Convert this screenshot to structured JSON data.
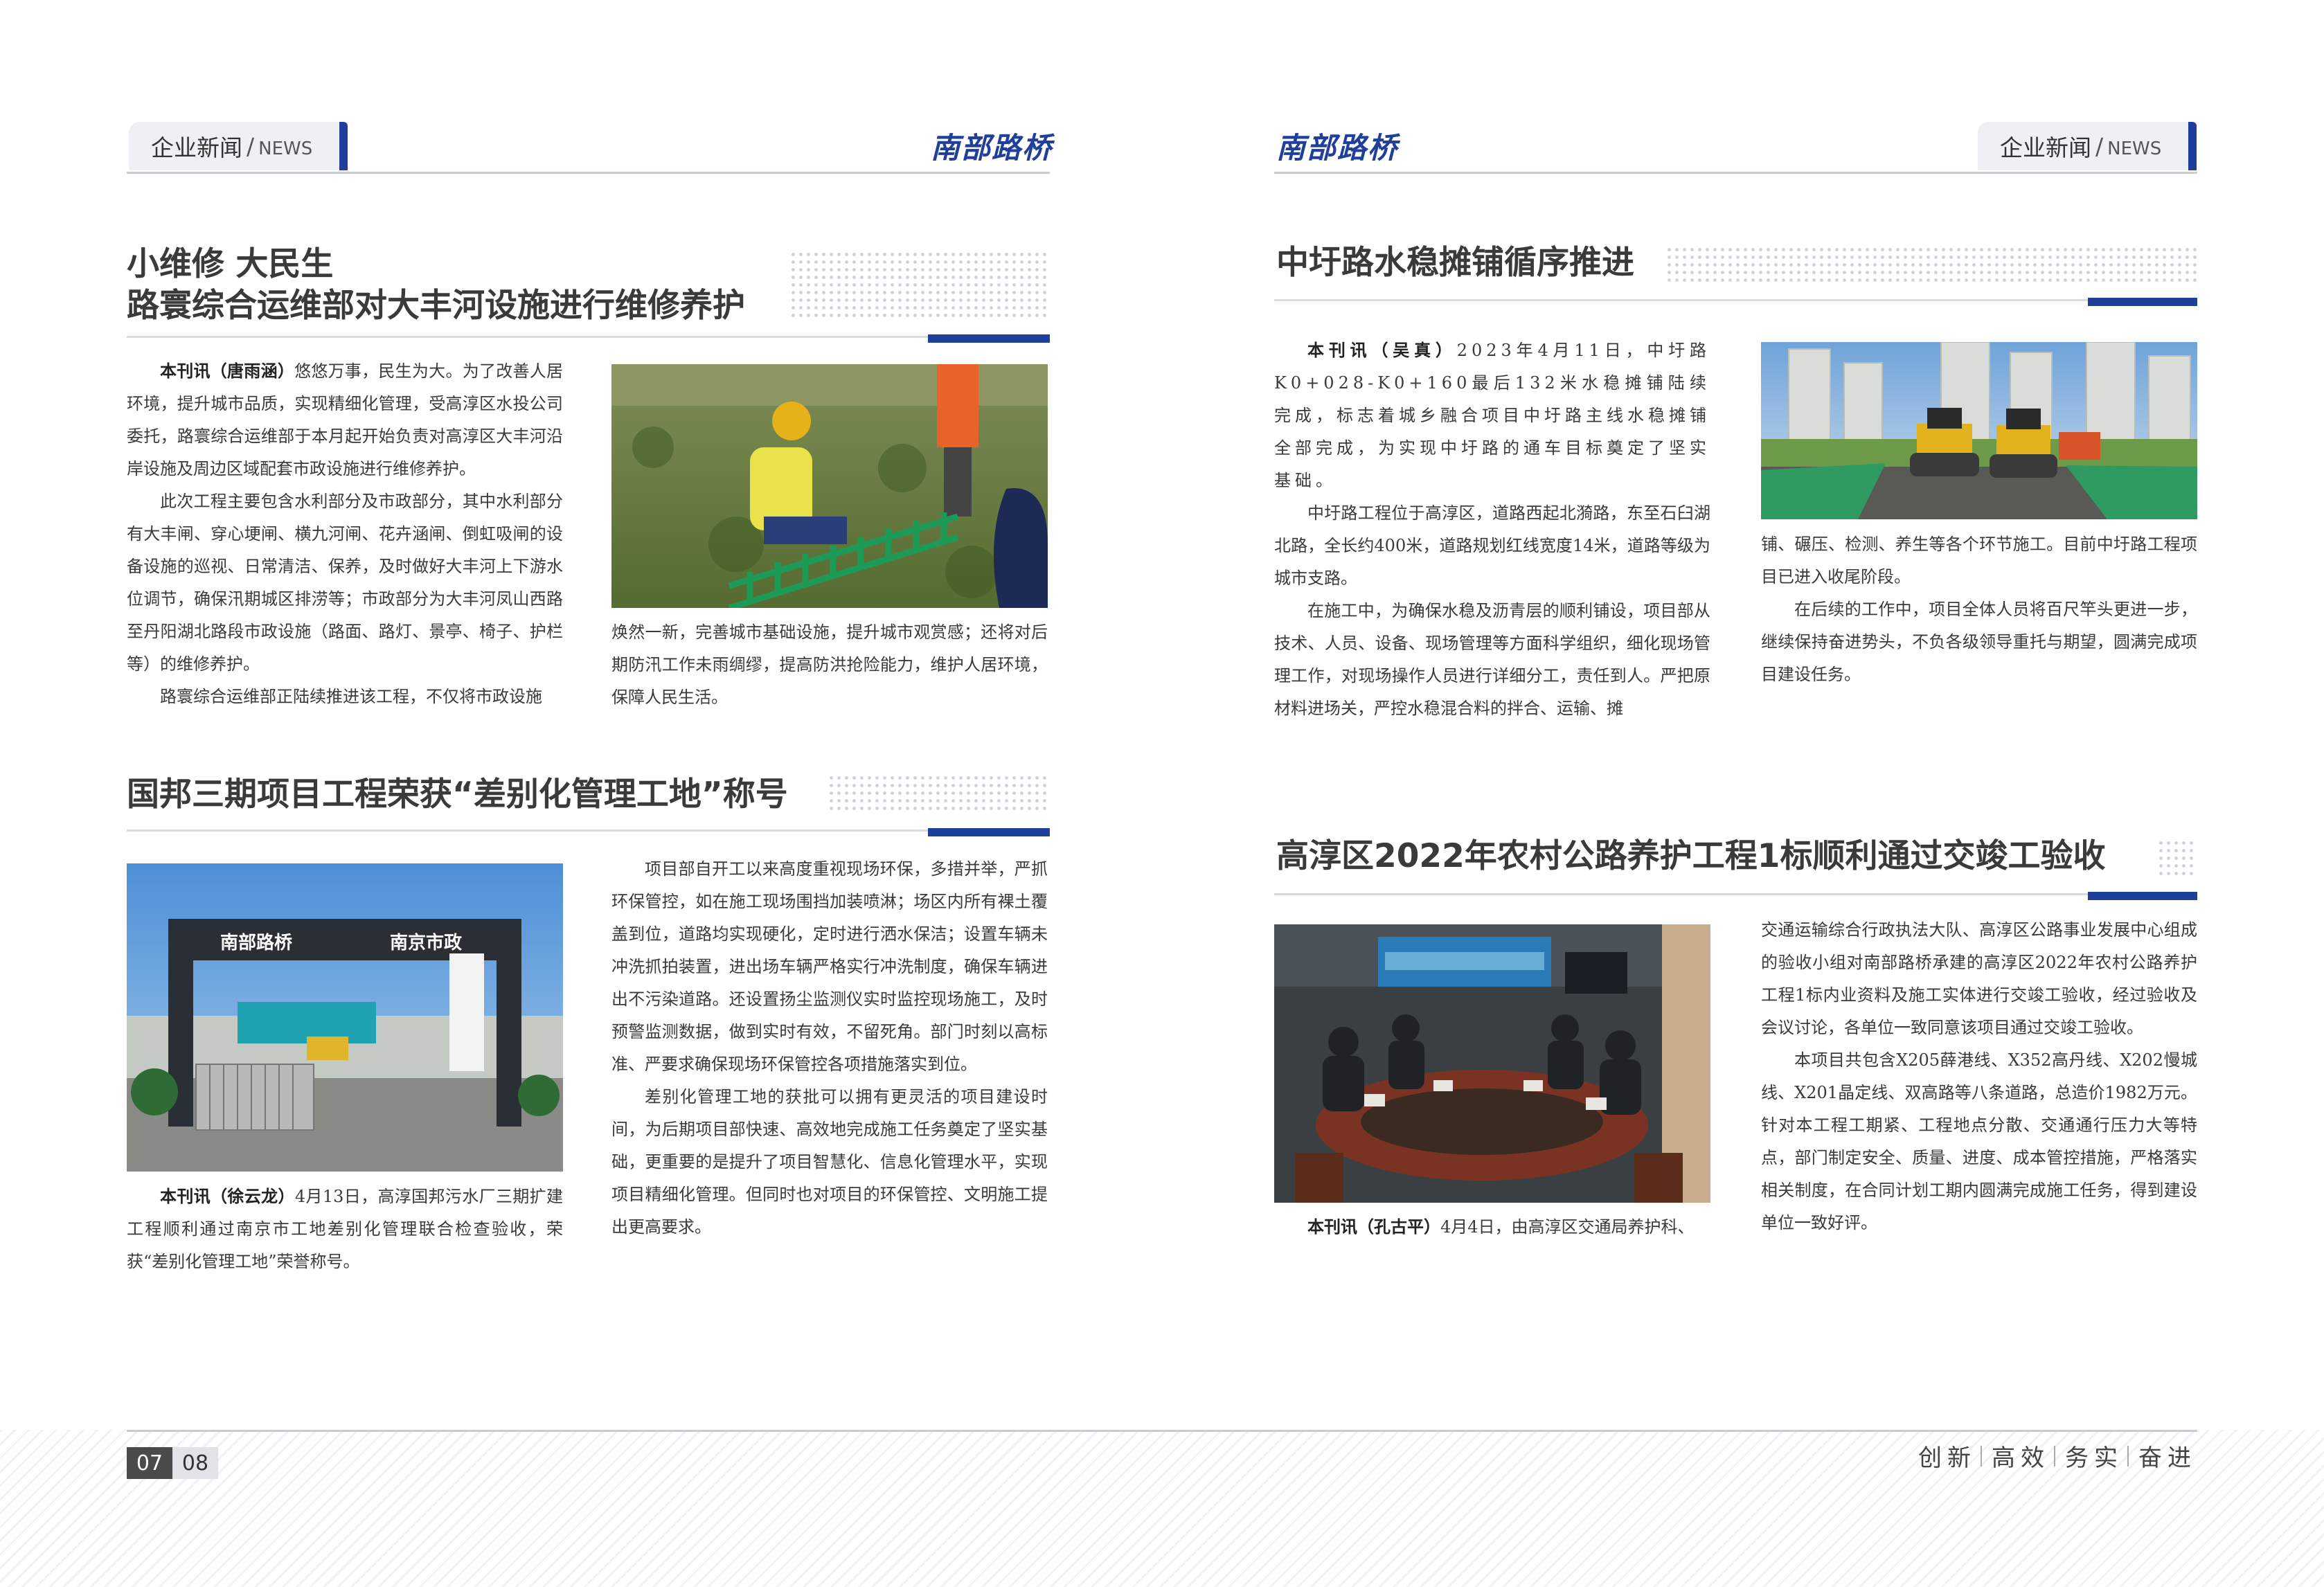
{
  "header": {
    "tab_cn": "企业新闻",
    "tab_slash": "/",
    "tab_en": "NEWS",
    "brand": "南部路桥"
  },
  "article1": {
    "title_line1": "小维修 大民生",
    "title_line2": "路寰综合运维部对大丰河设施进行维修养护",
    "byline": "本刊讯（唐雨涵）",
    "p1": "悠悠万事，民生为大。为了改善人居环境，提升城市品质，实现精细化管理，受高淳区水投公司委托，路寰综合运维部于本月起开始负责对高淳区大丰河沿岸设施及周边区域配套市政设施进行维修养护。",
    "p2": "此次工程主要包含水利部分及市政部分，其中水利部分有大丰闸、穿心埂闸、横九河闸、花卉涵闸、倒虹吸闸的设备设施的巡视、日常清洁、保养，及时做好大丰河上下游水位调节，确保汛期城区排涝等；市政部分为大丰河凤山西路至丹阳湖北路段市政设施（路面、路灯、景亭、椅子、护栏等）的维修养护。",
    "p3a": "路寰综合运维部正陆续推进该工程，不仅将市政设施",
    "p3b": "焕然一新，完善城市基础设施，提升城市观赏感；还将对后期防汛工作未雨绸缪，提高防洪抢险能力，维护人居环境，保障人民生活。"
  },
  "article2": {
    "title": "国邦三期项目工程荣获“差别化管理工地”称号",
    "byline": "本刊讯（徐云龙）",
    "p1": "4月13日，高淳国邦污水厂三期扩建工程顺利通过南京市工地差别化管理联合检查验收，荣获“差别化管理工地”荣誉称号。",
    "p2": "项目部自开工以来高度重视现场环保，多措并举，严抓环保管控，如在施工现场围挡加装喷淋；场区内所有裸土覆盖到位，道路均实现硬化，定时进行洒水保洁；设置车辆未冲洗抓拍装置，进出场车辆严格实行冲洗制度，确保车辆进出不污染道路。还设置扬尘监测仪实时监控现场施工，及时预警监测数据，做到实时有效，不留死角。部门时刻以高标准、严要求确保现场环保管控各项措施落实到位。",
    "p3": "差别化管理工地的获批可以拥有更灵活的项目建设时间，为后期项目部快速、高效地完成施工任务奠定了坚实基础，更重要的是提升了项目智慧化、信息化管理水平，实现项目精细化管理。但同时也对项目的环保管控、文明施工提出更高要求。",
    "gate_sign_left": "南部路桥",
    "gate_sign_right": "南京市政"
  },
  "article3": {
    "title": "中圩路水稳摊铺循序推进",
    "byline": "本刊讯（吴真）",
    "p1": "2023年4月11日，中圩路K0+028-K0+160最后132米水稳摊铺陆续完成，标志着城乡融合项目中圩路主线水稳摊铺全部完成，为实现中圩路的通车目标奠定了坚实基础。",
    "p2": "中圩路工程位于高淳区，道路西起北漪路，东至石臼湖北路，全长约400米，道路规划红线宽度14米，道路等级为城市支路。",
    "p3a": "在施工中，为确保水稳及沥青层的顺利铺设，项目部从技术、人员、设备、现场管理等方面科学组织，细化现场管理工作，对现场操作人员进行详细分工，责任到人。严把原材料进场关，严控水稳混合料的拌合、运输、摊",
    "p3b": "铺、碾压、检测、养生等各个环节施工。目前中圩路工程项目已进入收尾阶段。",
    "p4": "在后续的工作中，项目全体人员将百尺竿头更进一步，继续保持奋进势头，不负各级领导重托与期望，圆满完成项目建设任务。"
  },
  "article4": {
    "title": "高淳区2022年农村公路养护工程1标顺利通过交竣工验收",
    "byline": "本刊讯（孔古平）",
    "p1a": "4月4日，由高淳区交通局养护科、",
    "p1b": "交通运输综合行政执法大队、高淳区公路事业发展中心组成的验收小组对南部路桥承建的高淳区2022年农村公路养护工程1标内业资料及施工实体进行交竣工验收，经过验收及会议讨论，各单位一致同意该项目通过交竣工验收。",
    "p2": "本项目共包含X205薛港线、X352高丹线、X202慢城线、X201晶定线、双高路等八条道路，总造价1982万元。针对本工程工期紧、工程地点分散、交通通行压力大等特点，部门制定安全、质量、进度、成本管控措施，严格落实相关制度，在合同计划工期内圆满完成施工任务，得到建设单位一致好评。"
  },
  "footer": {
    "page_left": "07",
    "page_right": "08",
    "slogan": [
      "创新",
      "高效",
      "务实",
      "奋进"
    ]
  },
  "colors": {
    "brand_blue": "#1f3f9a",
    "title_gray": "#3a3a3a",
    "tab_bg": "#eef0f3"
  }
}
